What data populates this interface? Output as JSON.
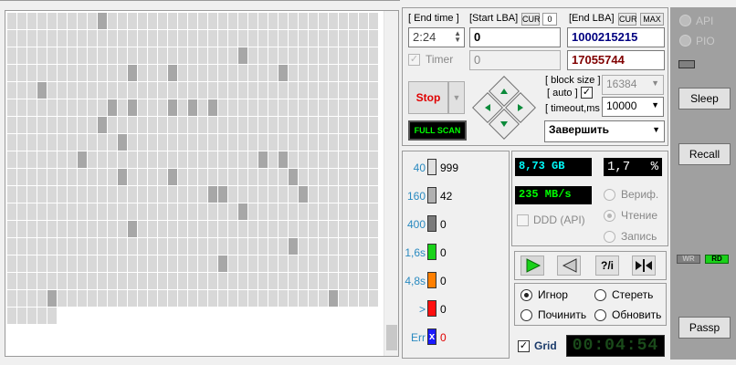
{
  "map": {
    "cols": 37,
    "rows": 18,
    "last_row_cells": 5,
    "slow_cells": [
      [
        4,
        16
      ],
      [
        32,
        16
      ],
      [
        12,
        12
      ],
      [
        7,
        8
      ],
      [
        12,
        5
      ],
      [
        9,
        0
      ],
      [
        10,
        5
      ],
      [
        16,
        5
      ],
      [
        20,
        5
      ],
      [
        25,
        8
      ],
      [
        29,
        10
      ],
      [
        11,
        7
      ],
      [
        18,
        5
      ],
      [
        3,
        4
      ],
      [
        12,
        3
      ],
      [
        27,
        3
      ],
      [
        27,
        8
      ],
      [
        16,
        3
      ],
      [
        9,
        6
      ],
      [
        11,
        9
      ],
      [
        20,
        10
      ],
      [
        21,
        10
      ],
      [
        23,
        11
      ],
      [
        16,
        9
      ],
      [
        28,
        9
      ],
      [
        28,
        13
      ],
      [
        21,
        14
      ],
      [
        23,
        2
      ]
    ]
  },
  "time": {
    "end_label": "[ End time ]",
    "value": "2:24",
    "timer_label": "Timer"
  },
  "lba": {
    "start_label": "[Start LBA]",
    "cur_btn": "CUR",
    "cur_value": "0",
    "start_value": "0",
    "start2_value": "0",
    "end_label": "[End LBA]",
    "cur2_btn": "CUR",
    "max_btn": "MAX",
    "end_value": "1000215215",
    "end2_value": "17055744"
  },
  "controls": {
    "stop_label": "Stop",
    "fullscan_label": "FULL SCAN",
    "block_size_label": "[ block size ]",
    "auto_label": "[ auto ]",
    "block_size_value": "16384",
    "timeout_label": "[ timeout,ms ]",
    "timeout_value": "10000",
    "action_value": "Завершить"
  },
  "legend": [
    {
      "label": "40",
      "count": "999",
      "color": "#e0e0e0"
    },
    {
      "label": "160",
      "count": "42",
      "color": "#b0b0b0"
    },
    {
      "label": "400",
      "count": "0",
      "color": "#7a7a7a"
    },
    {
      "label": "1,6s",
      "count": "0",
      "color": "#19d219"
    },
    {
      "label": "4,8s",
      "count": "0",
      "color": "#ff7f00"
    },
    {
      "label": ">",
      "count": "0",
      "color": "#ff1010"
    },
    {
      "label": "Err",
      "count": "0",
      "color": "#1a1aff",
      "mark": "x"
    }
  ],
  "stats": {
    "size_value": "8,73 GB",
    "percent_value": "1,7",
    "percent_unit": "%",
    "speed_value": "235 MB/s",
    "ddd_label": "DDD (API)",
    "verify_label": "Вериф.",
    "read_label": "Чтение",
    "write_label": "Запись"
  },
  "playback": {
    "play_icon": "play-icon",
    "back_icon": "back-icon",
    "skip_label": "?/i",
    "end_label": "end"
  },
  "mode": {
    "ignore_label": "Игнор",
    "erase_label": "Стереть",
    "repair_label": "Починить",
    "refresh_label": "Обновить"
  },
  "grid": {
    "label": "Grid",
    "clock": "00:04:54"
  },
  "right": {
    "api_label": "API",
    "pio_label": "PIO",
    "sleep_label": "Sleep",
    "recall_label": "Recall",
    "wr_label": "WR",
    "rd_label": "RD",
    "passp_label": "Passp"
  },
  "colors": {
    "stop": "#e00000",
    "cyan": "#00ffff",
    "green": "#00ff00",
    "accent": "#2a8ac0"
  }
}
